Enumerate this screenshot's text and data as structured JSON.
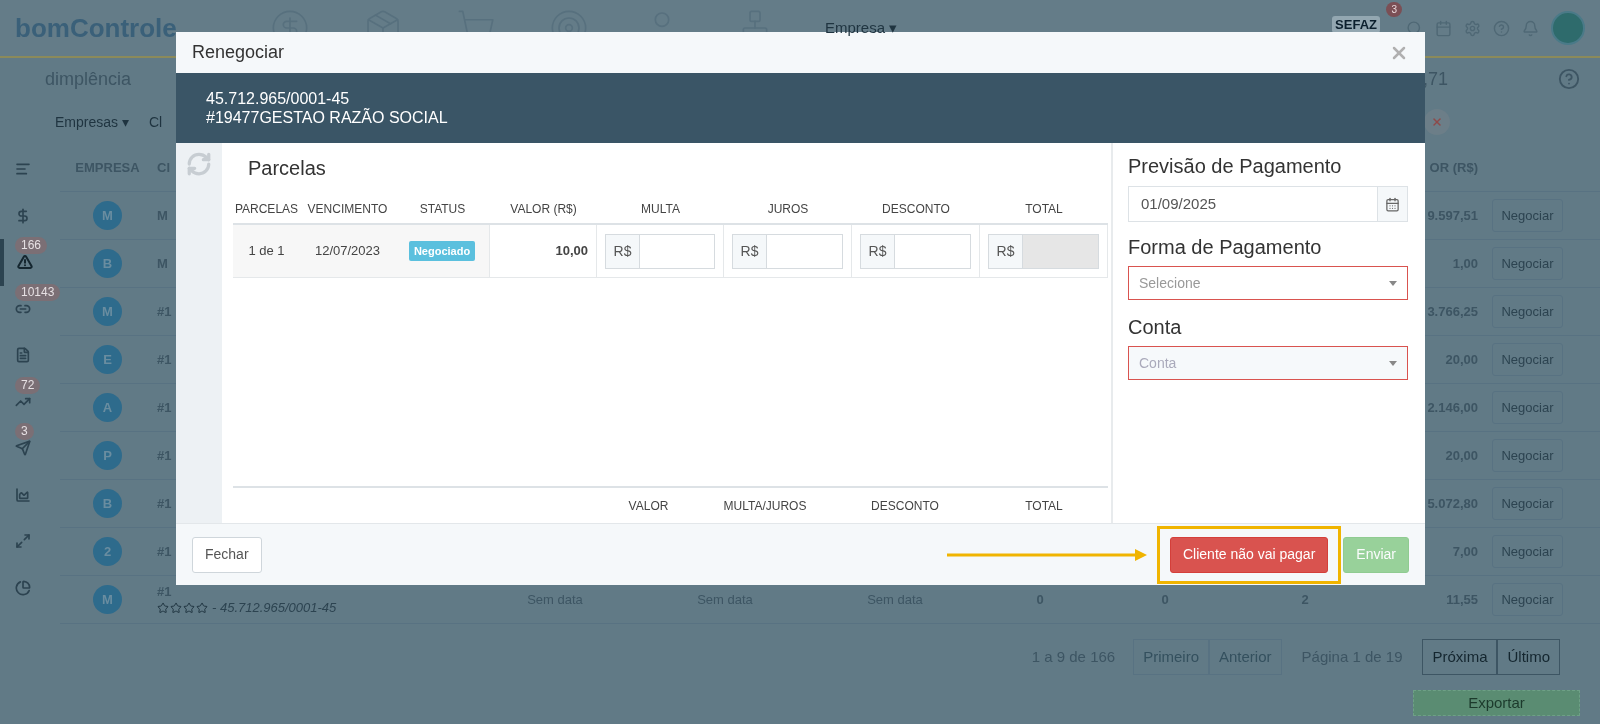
{
  "topbar": {
    "logo": "bomControle",
    "company_menu": "Empresa",
    "company_menu_caret": "▾",
    "sefaz_label": "SEFAZ",
    "sefaz_badge": "3"
  },
  "page": {
    "title": "dimplência",
    "total_fragment": ",71",
    "filters": [
      {
        "label": "Empresas",
        "caret": "▾"
      },
      {
        "label": "Cl"
      }
    ]
  },
  "sidebar": {
    "items": [
      {
        "selected": false
      },
      {
        "selected": false
      },
      {
        "selected": true,
        "badge": "166"
      },
      {
        "selected": false,
        "badge": "10143"
      },
      {
        "selected": false
      },
      {
        "selected": false,
        "badge": "72"
      },
      {
        "selected": false,
        "badge": "3"
      },
      {
        "selected": false
      },
      {
        "selected": false
      },
      {
        "selected": false
      }
    ]
  },
  "table": {
    "columns": [
      "EMPRESA",
      "Cl",
      "OR (R$)"
    ],
    "rows": [
      {
        "avatar": "M",
        "client": "M",
        "value": "9.597,51",
        "action": "Negociar"
      },
      {
        "avatar": "B",
        "client": "M",
        "value": "1,00",
        "action": "Negociar"
      },
      {
        "avatar": "M",
        "client": "#1",
        "value": "3.766,25",
        "action": "Negociar"
      },
      {
        "avatar": "E",
        "client": "#1",
        "value": "20,00",
        "action": "Negociar"
      },
      {
        "avatar": "A",
        "client": "#1",
        "value": "2.146,00",
        "action": "Negociar"
      },
      {
        "avatar": "P",
        "client": "#1",
        "value": "20,00",
        "action": "Negociar"
      },
      {
        "avatar": "B",
        "client": "#1",
        "value": "5.072,80",
        "action": "Negociar"
      },
      {
        "avatar": "2",
        "client": "#1",
        "value": "7,00",
        "action": "Negociar"
      },
      {
        "avatar": "M",
        "client": "#1",
        "stars": 0,
        "document": "- 45.712.965/0001-45",
        "cells": [
          "Sem data",
          "Sem data",
          "Sem data",
          "0",
          "0",
          "2"
        ],
        "value": "11,55",
        "action": "Negociar"
      }
    ]
  },
  "pagination": {
    "range": "1 a 9 de 166",
    "page": "Página 1 de 19",
    "buttons": [
      {
        "label": "Primeiro",
        "disabled": true
      },
      {
        "label": "Anterior",
        "disabled": true
      },
      {
        "label": "Próxima",
        "disabled": false
      },
      {
        "label": "Último",
        "disabled": false
      }
    ]
  },
  "export_button": "Exportar",
  "modal": {
    "title": "Renegociar",
    "document": "45.712.965/0001-45",
    "company": "#19477GESTAO RAZÃO SOCIAL",
    "installments": {
      "title": "Parcelas",
      "columns": [
        "PARCELAS",
        "VENCIMENTO",
        "STATUS",
        "VALOR (R$)",
        "MULTA",
        "JUROS",
        "DESCONTO",
        "TOTAL"
      ],
      "rows": [
        {
          "installment": "1 de 1",
          "due_date": "12/07/2023",
          "status": "Negociado",
          "value": "10,00",
          "fields": [
            {
              "prefix": "R$",
              "disabled": false
            },
            {
              "prefix": "R$",
              "disabled": false
            },
            {
              "prefix": "R$",
              "disabled": false
            },
            {
              "prefix": "R$",
              "disabled": true
            }
          ]
        }
      ],
      "summary_columns": [
        "VALOR",
        "MULTA/JUROS",
        "DESCONTO",
        "TOTAL"
      ]
    },
    "payment": {
      "forecast_label": "Previsão de Pagamento",
      "forecast_date": "01/09/2025",
      "method_label": "Forma de Pagamento",
      "method_placeholder": "Selecione",
      "method_invalid": true,
      "account_label": "Conta",
      "account_placeholder": "Conta",
      "account_invalid": true
    },
    "buttons": [
      {
        "label": "Fechar",
        "kind": "default",
        "highlighted": false,
        "disabled": false
      },
      {
        "label": "Cliente não vai pagar",
        "kind": "danger",
        "highlighted": true,
        "disabled": false
      },
      {
        "label": "Enviar",
        "kind": "success",
        "highlighted": false,
        "disabled": true
      }
    ]
  }
}
